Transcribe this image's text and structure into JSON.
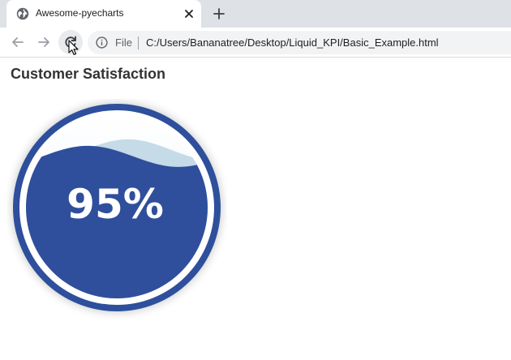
{
  "browser": {
    "tab": {
      "title": "Awesome-pyecharts",
      "icon": "globe-icon",
      "close_icon": "close-icon"
    },
    "new_tab_icon": "plus-icon",
    "toolbar": {
      "back_icon": "arrow-left-icon",
      "forward_icon": "arrow-right-icon",
      "reload_icon": "reload-icon",
      "info_icon": "info-icon",
      "scheme_label": "File",
      "url": "C:/Users/Bananatree/Desktop/Liquid_KPI/Basic_Example.html"
    }
  },
  "page": {
    "title": "Customer Satisfaction"
  },
  "chart_data": {
    "type": "liquidfill",
    "title": "Customer Satisfaction",
    "values": [
      0.95
    ],
    "label": "95%",
    "colors": {
      "fill": "#2f4f9c",
      "border": "#2f4f9c",
      "wave_light": "#c5dbe7"
    }
  }
}
